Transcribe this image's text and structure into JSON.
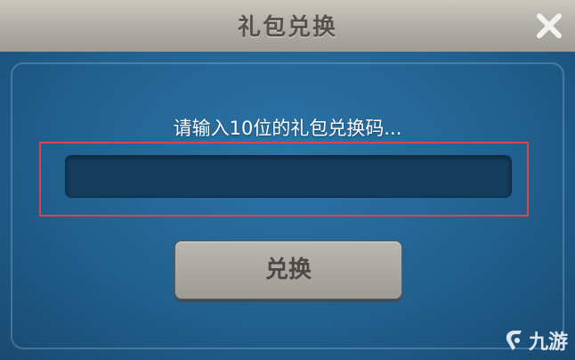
{
  "dialog": {
    "title": "礼包兑换",
    "prompt": "请输入10位的礼包兑换码...",
    "code_input": {
      "value": "",
      "placeholder": ""
    },
    "redeem_button_label": "兑换"
  },
  "watermark": {
    "text": "九游",
    "icon": "jiuyou-logo-icon"
  },
  "colors": {
    "panel_blue": "#22618f",
    "titlebar_gray": "#aeaca4",
    "highlight_red": "#d8454d",
    "input_dark": "#143c5c"
  }
}
